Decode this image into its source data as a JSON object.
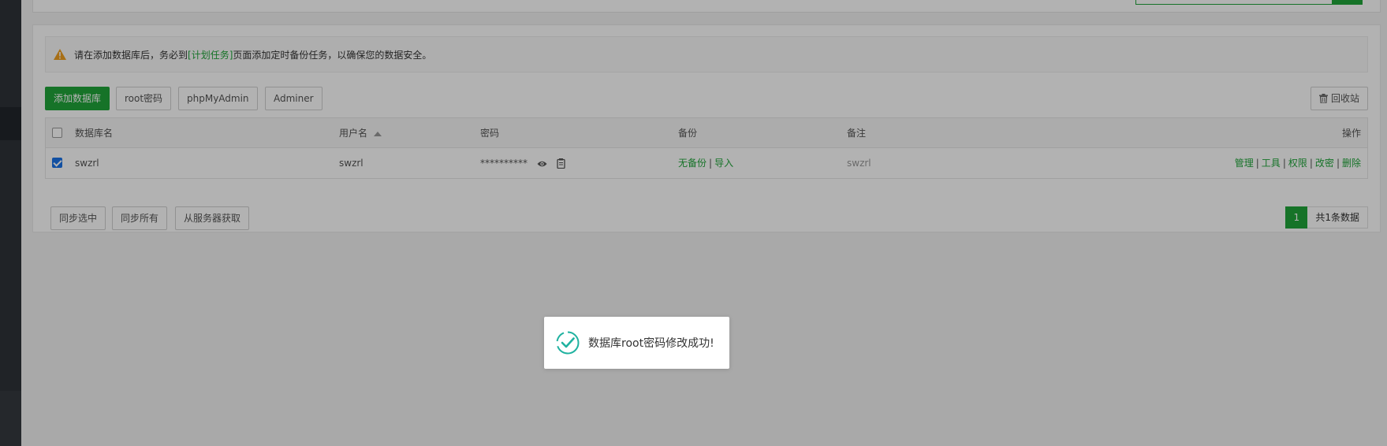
{
  "notice": {
    "text_before": "请在添加数据库后，务必到",
    "link": "[计划任务]",
    "text_after": "页面添加定时备份任务，以确保您的数据安全。"
  },
  "toolbar": {
    "add_db": "添加数据库",
    "root_password": "root密码",
    "phpmyadmin": "phpMyAdmin",
    "adminer": "Adminer",
    "recycle": "回收站"
  },
  "table": {
    "headers": {
      "name": "数据库名",
      "user": "用户名",
      "password": "密码",
      "backup": "备份",
      "note": "备注",
      "action": "操作"
    },
    "rows": [
      {
        "name": "swzrl",
        "user": "swzrl",
        "password": "**********",
        "backup_none": "无备份",
        "backup_import": "导入",
        "note": "swzrl",
        "actions": [
          "管理",
          "工具",
          "权限",
          "改密",
          "删除"
        ]
      }
    ]
  },
  "bottom": {
    "sync_selected": "同步选中",
    "sync_all": "同步所有",
    "fetch_from_server": "从服务器获取"
  },
  "pager": {
    "current": "1",
    "total": "共1条数据"
  },
  "toast": {
    "message": "数据库root密码修改成功!"
  },
  "colors": {
    "accent": "#20a53a",
    "sidebar": "#2f3338",
    "checkbox": "#1a73e8",
    "warning": "#f0a020",
    "toast_icon": "#20b2a0"
  }
}
